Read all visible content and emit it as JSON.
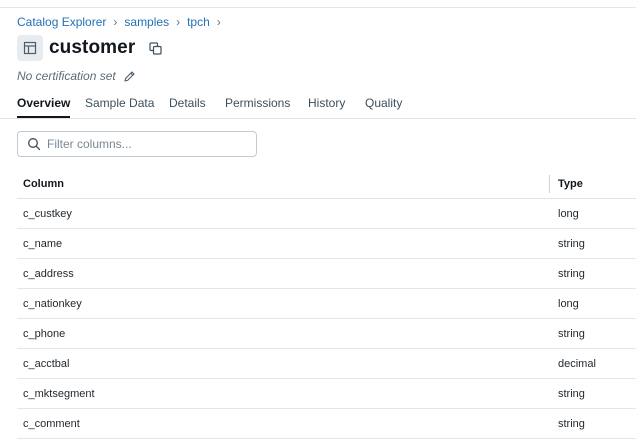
{
  "breadcrumb": {
    "items": [
      "Catalog Explorer",
      "samples",
      "tpch"
    ],
    "separator": "›"
  },
  "header": {
    "title": "customer",
    "icon": "table-icon",
    "copy_icon": "copy-icon"
  },
  "certification": {
    "text": "No certification set",
    "edit_icon": "pencil-icon"
  },
  "tabs": [
    {
      "label": "Overview",
      "active": true
    },
    {
      "label": "Sample Data",
      "active": false
    },
    {
      "label": "Details",
      "active": false
    },
    {
      "label": "Permissions",
      "active": false
    },
    {
      "label": "History",
      "active": false
    },
    {
      "label": "Quality",
      "active": false
    }
  ],
  "filter": {
    "placeholder": "Filter columns...",
    "value": "",
    "icon": "search-icon"
  },
  "columns_table": {
    "headers": [
      "Column",
      "Type"
    ],
    "rows": [
      [
        "c_custkey",
        "long"
      ],
      [
        "c_name",
        "string"
      ],
      [
        "c_address",
        "string"
      ],
      [
        "c_nationkey",
        "long"
      ],
      [
        "c_phone",
        "string"
      ],
      [
        "c_acctbal",
        "decimal"
      ],
      [
        "c_mktsegment",
        "string"
      ],
      [
        "c_comment",
        "string"
      ]
    ]
  },
  "colors": {
    "link": "#2272b4",
    "text": "#1f272d",
    "border": "#dfe3e7"
  }
}
